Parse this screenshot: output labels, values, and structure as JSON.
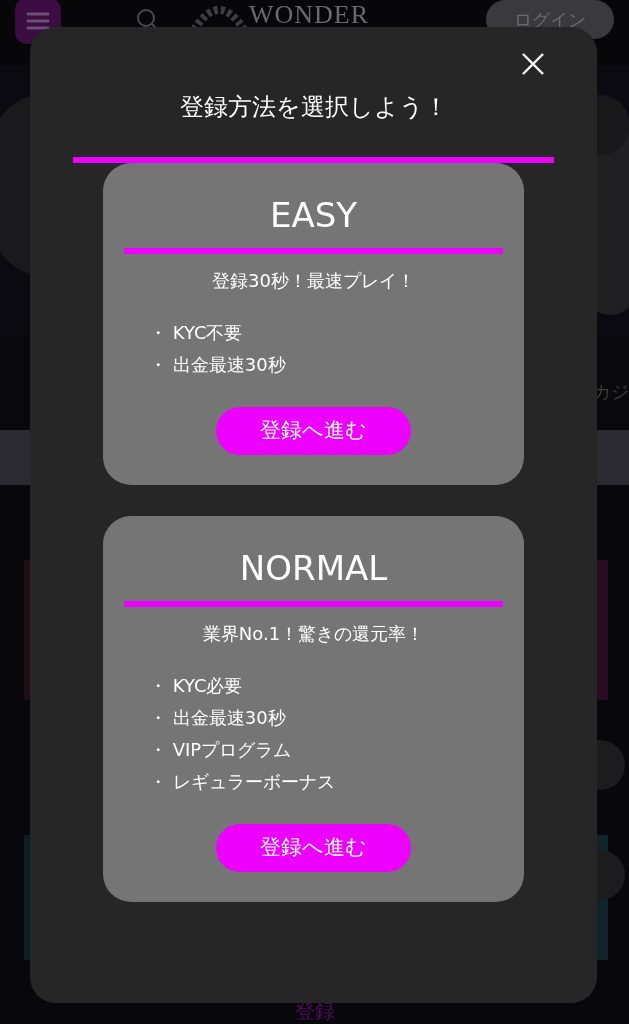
{
  "header": {
    "logo": "WONDER",
    "login_button": "ログイン"
  },
  "background": {
    "hero_text": "カジ",
    "footer_text": "登録"
  },
  "modal": {
    "title": "登録方法を選択しよう！",
    "plans": [
      {
        "name": "EASY",
        "tagline": "登録30秒！最速プレイ！",
        "features": [
          "・ KYC不要",
          "・ 出金最速30秒"
        ],
        "button": "登録へ進む"
      },
      {
        "name": "NORMAL",
        "tagline": "業界No.1！驚きの還元率！",
        "features": [
          "・ KYC必要",
          "・ 出金最速30秒",
          "・ VIPプログラム",
          "・ レギュラーボーナス"
        ],
        "button": "登録へ進む"
      }
    ]
  }
}
